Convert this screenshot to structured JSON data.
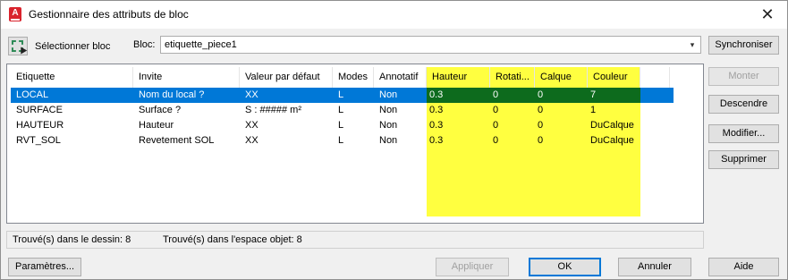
{
  "window": {
    "title": "Gestionnaire des attributs de bloc",
    "app_icon_letter": "A",
    "close_glyph": "✕"
  },
  "toolbar": {
    "select_block_label": "Sélectionner bloc",
    "block_label": "Bloc:",
    "block_value": "etiquette_piece1",
    "dropdown_glyph": "▾"
  },
  "table": {
    "highlight_color": "#ffff40",
    "selected_color": "#0078d7",
    "selected_highlight_color": "#0d6b1d",
    "columns": [
      "Etiquette",
      "Invite",
      "Valeur par défaut",
      "Modes",
      "Annotatif",
      "Hauteur",
      "Rotati...",
      "Calque",
      "Couleur"
    ],
    "rows": [
      [
        "LOCAL",
        "Nom du local ?",
        "XX",
        "L",
        "Non",
        "0.3",
        "0",
        "0",
        "7"
      ],
      [
        "SURFACE",
        "Surface ?",
        "S : ##### m²",
        "L",
        "Non",
        "0.3",
        "0",
        "0",
        "1"
      ],
      [
        "HAUTEUR",
        "Hauteur",
        "XX",
        "L",
        "Non",
        "0.3",
        "0",
        "0",
        "DuCalque"
      ],
      [
        "RVT_SOL",
        "Revetement SOL",
        "XX",
        "L",
        "Non",
        "0.3",
        "0",
        "0",
        "DuCalque"
      ]
    ],
    "selected_row": 0
  },
  "side_buttons": {
    "synchronize": "Synchroniser",
    "move_up": "Monter",
    "move_down": "Descendre",
    "edit": "Modifier...",
    "remove": "Supprimer"
  },
  "status": {
    "found_in_drawing": "Trouvé(s) dans le dessin: 8",
    "found_in_space": "Trouvé(s) dans l'espace objet: 8"
  },
  "footer": {
    "settings": "Paramètres...",
    "apply": "Appliquer",
    "ok": "OK",
    "cancel": "Annuler",
    "help": "Aide"
  }
}
